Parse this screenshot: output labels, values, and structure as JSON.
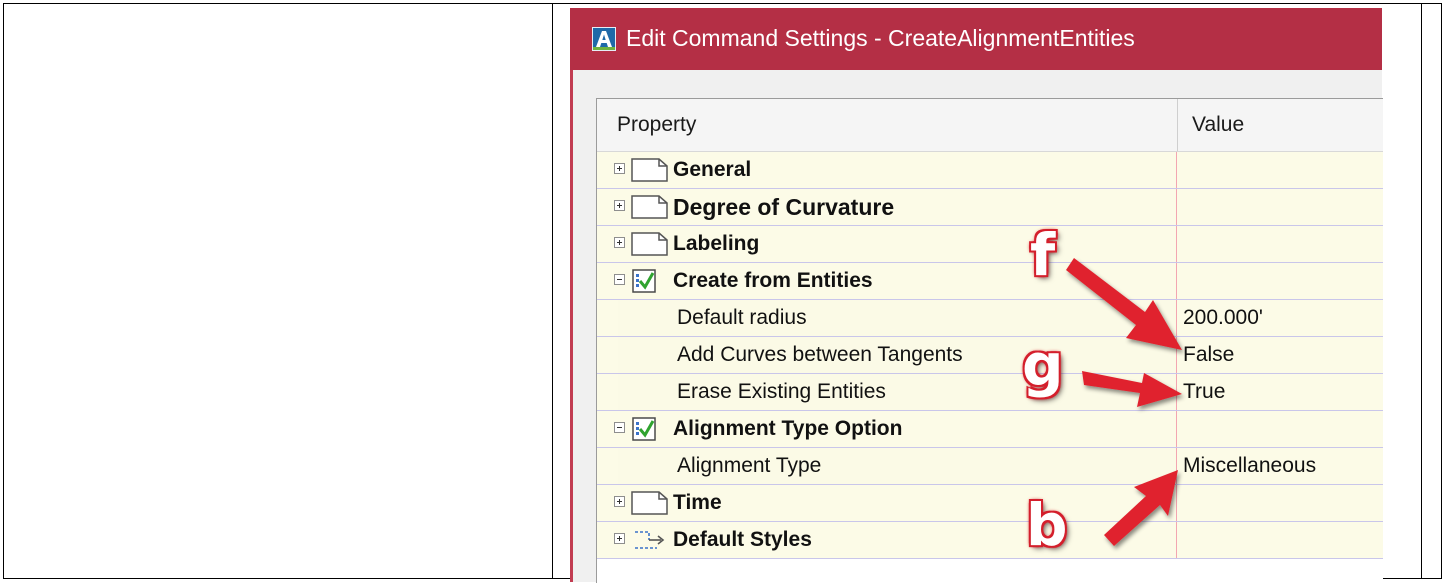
{
  "window": {
    "title": "Edit Command Settings - CreateAlignmentEntities",
    "app_icon": "autocad-a-icon",
    "title_bar_color": "#b42f45"
  },
  "grid": {
    "header": {
      "property": "Property",
      "value": "Value"
    },
    "rows": [
      {
        "kind": "category",
        "label": "General",
        "state": "collapsed",
        "icon": "blank-page-icon"
      },
      {
        "kind": "category",
        "label": "Degree of Curvature",
        "state": "collapsed",
        "icon": "blank-page-icon"
      },
      {
        "kind": "category",
        "label": "Labeling",
        "state": "collapsed",
        "icon": "blank-page-icon"
      },
      {
        "kind": "category",
        "label": "Create from Entities",
        "state": "expanded",
        "icon": "checked-settings-icon"
      },
      {
        "kind": "property",
        "label": "Default radius",
        "value": "200.000'"
      },
      {
        "kind": "property",
        "label": "Add Curves between Tangents",
        "value": "False"
      },
      {
        "kind": "property",
        "label": "Erase Existing Entities",
        "value": "True"
      },
      {
        "kind": "category",
        "label": "Alignment Type Option",
        "state": "expanded",
        "icon": "checked-settings-icon"
      },
      {
        "kind": "property",
        "label": "Alignment Type",
        "value": "Miscellaneous"
      },
      {
        "kind": "category",
        "label": "Time",
        "state": "collapsed",
        "icon": "blank-page-icon"
      },
      {
        "kind": "category",
        "label": "Default Styles",
        "state": "collapsed",
        "icon": "dashed-arrow-icon"
      }
    ]
  },
  "annotations": {
    "letters": [
      "f",
      "g",
      "b"
    ],
    "color": "#d4202d"
  }
}
